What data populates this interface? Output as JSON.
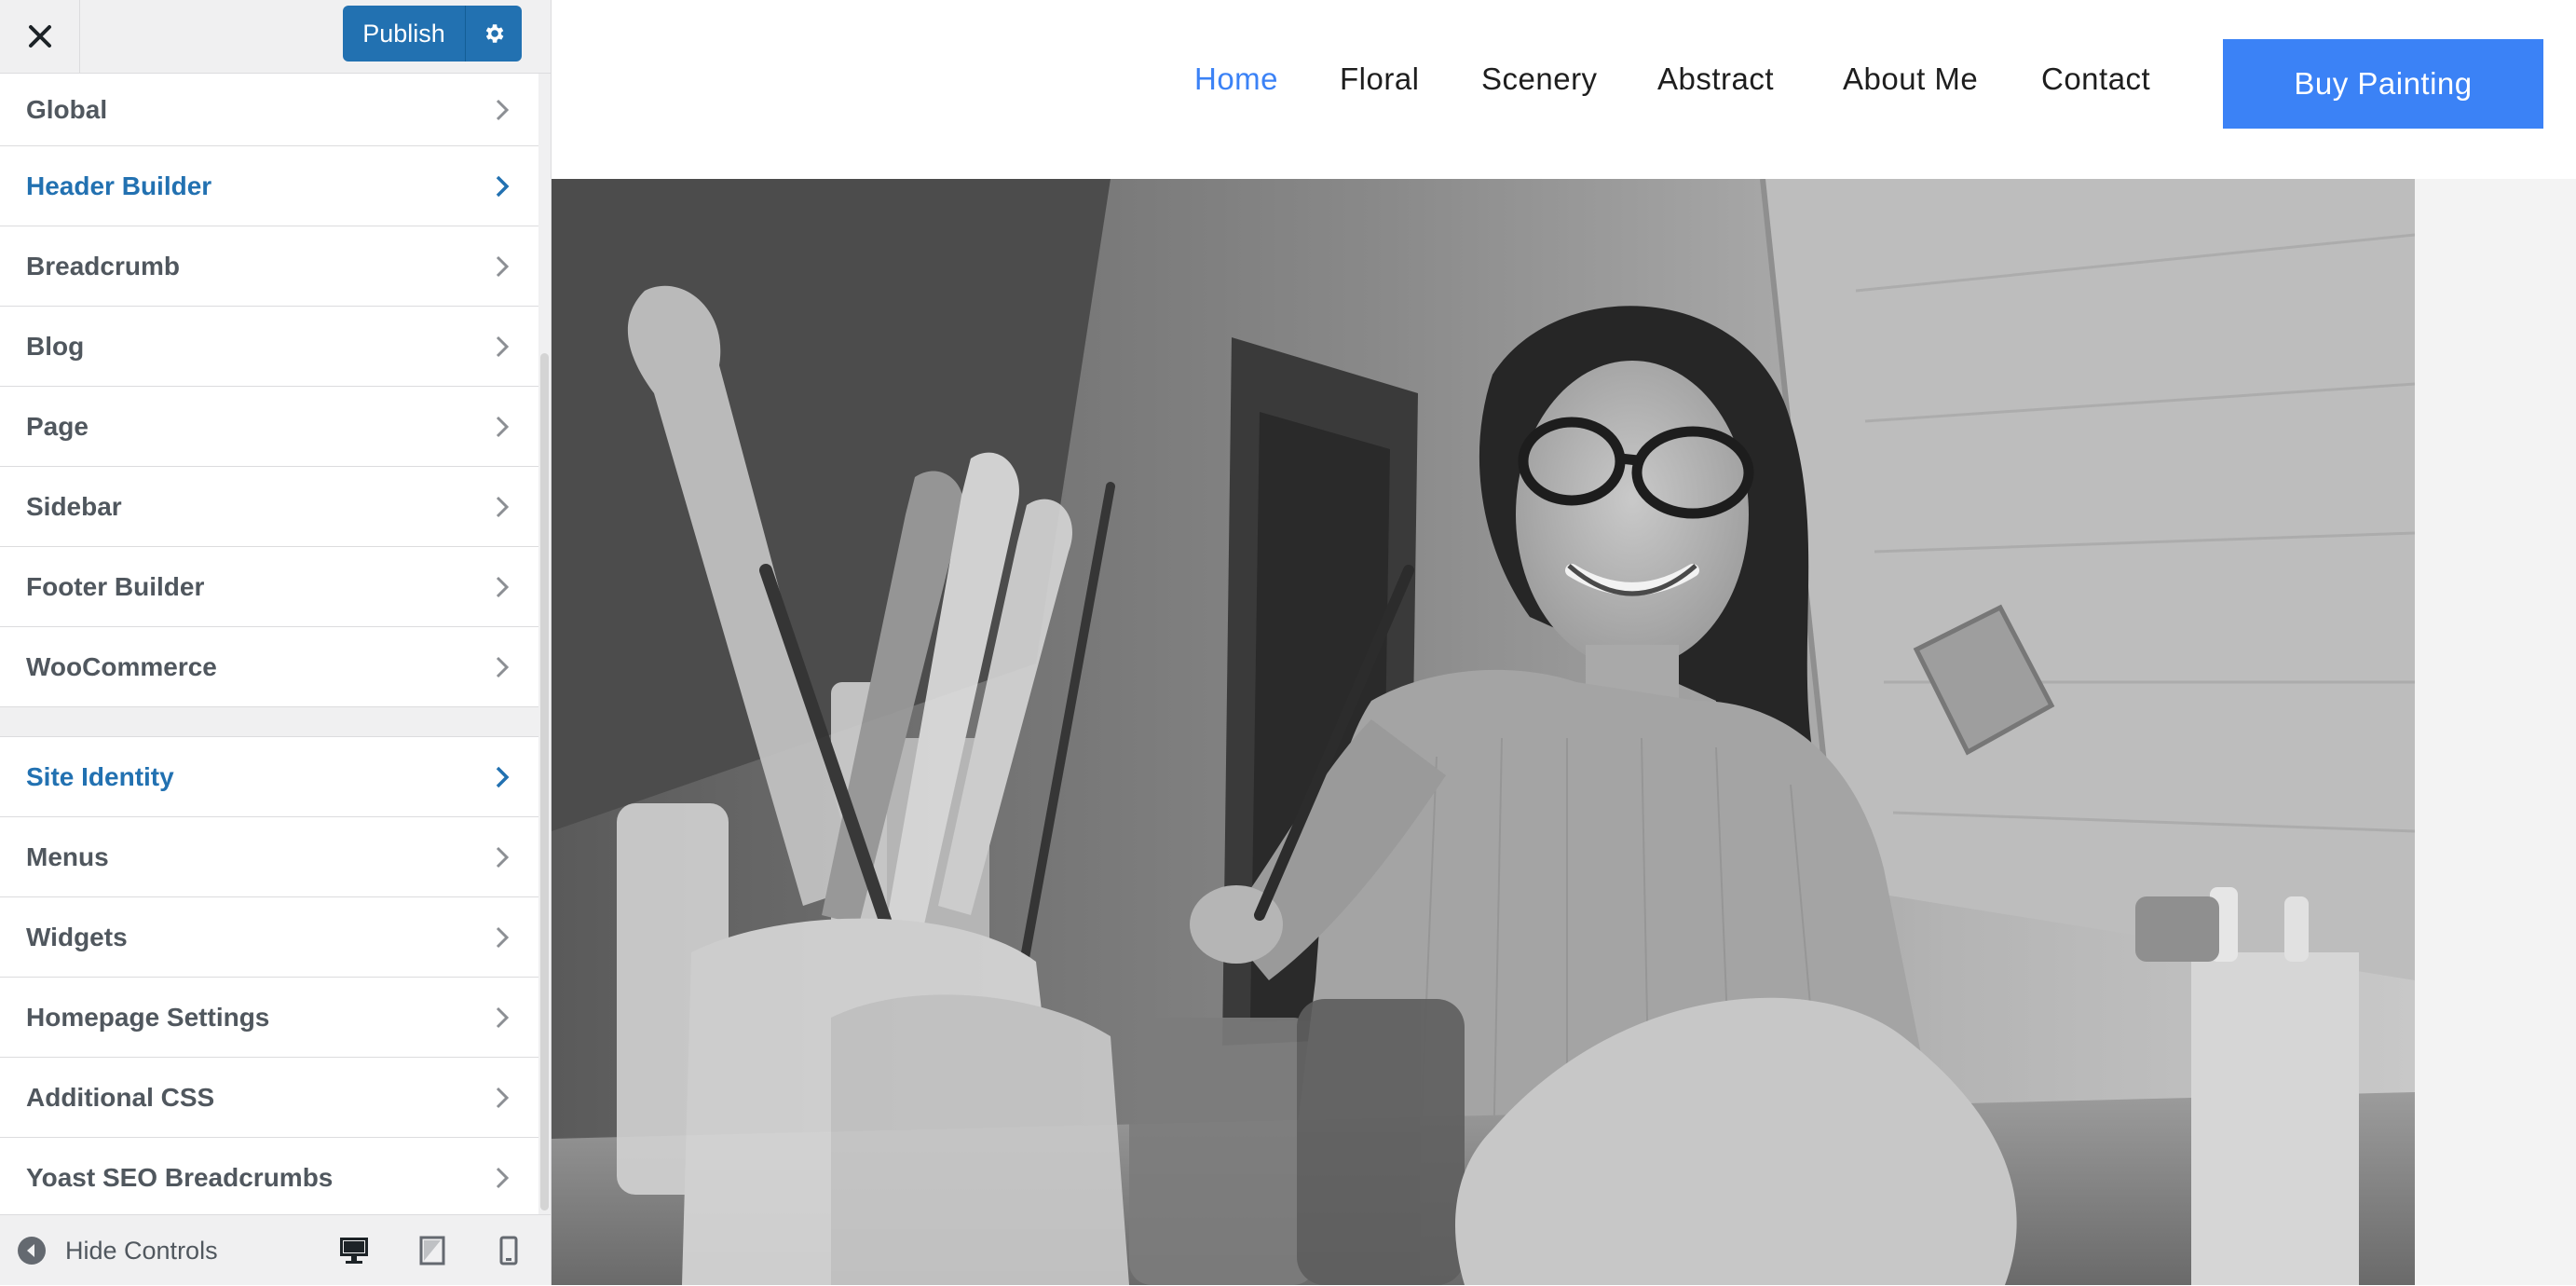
{
  "customizer": {
    "close_label": "×",
    "publish_label": "Publish",
    "sections_top": [
      {
        "label": "Global",
        "active": false
      },
      {
        "label": "Header Builder",
        "active": true
      },
      {
        "label": "Breadcrumb",
        "active": false
      },
      {
        "label": "Blog",
        "active": false
      },
      {
        "label": "Page",
        "active": false
      },
      {
        "label": "Sidebar",
        "active": false
      },
      {
        "label": "Footer Builder",
        "active": false
      },
      {
        "label": "WooCommerce",
        "active": false
      }
    ],
    "sections_bottom": [
      {
        "label": "Site Identity",
        "active": true
      },
      {
        "label": "Menus",
        "active": false
      },
      {
        "label": "Widgets",
        "active": false
      },
      {
        "label": "Homepage Settings",
        "active": false
      },
      {
        "label": "Additional CSS",
        "active": false
      },
      {
        "label": "Yoast SEO Breadcrumbs",
        "active": false
      }
    ],
    "footer": {
      "hide_controls_label": "Hide Controls",
      "devices": [
        "desktop-icon",
        "tablet-icon",
        "mobile-icon"
      ],
      "active_device": "desktop"
    },
    "colors": {
      "accent": "#2271b1",
      "text": "#50575e",
      "background": "#f0f0f1"
    }
  },
  "site": {
    "nav": [
      {
        "label": "Home",
        "current": true
      },
      {
        "label": "Floral",
        "current": false
      },
      {
        "label": "Scenery",
        "current": false
      },
      {
        "label": "Abstract",
        "current": false
      },
      {
        "label": "About Me",
        "current": false
      },
      {
        "label": "Contact",
        "current": false
      }
    ],
    "cta_label": "Buy Painting",
    "hero_image": "grayscale photo of a smiling woman with glasses painting with brushes at a table",
    "colors": {
      "accent": "#3b82f6",
      "nav_text": "#1e1e1e"
    }
  }
}
